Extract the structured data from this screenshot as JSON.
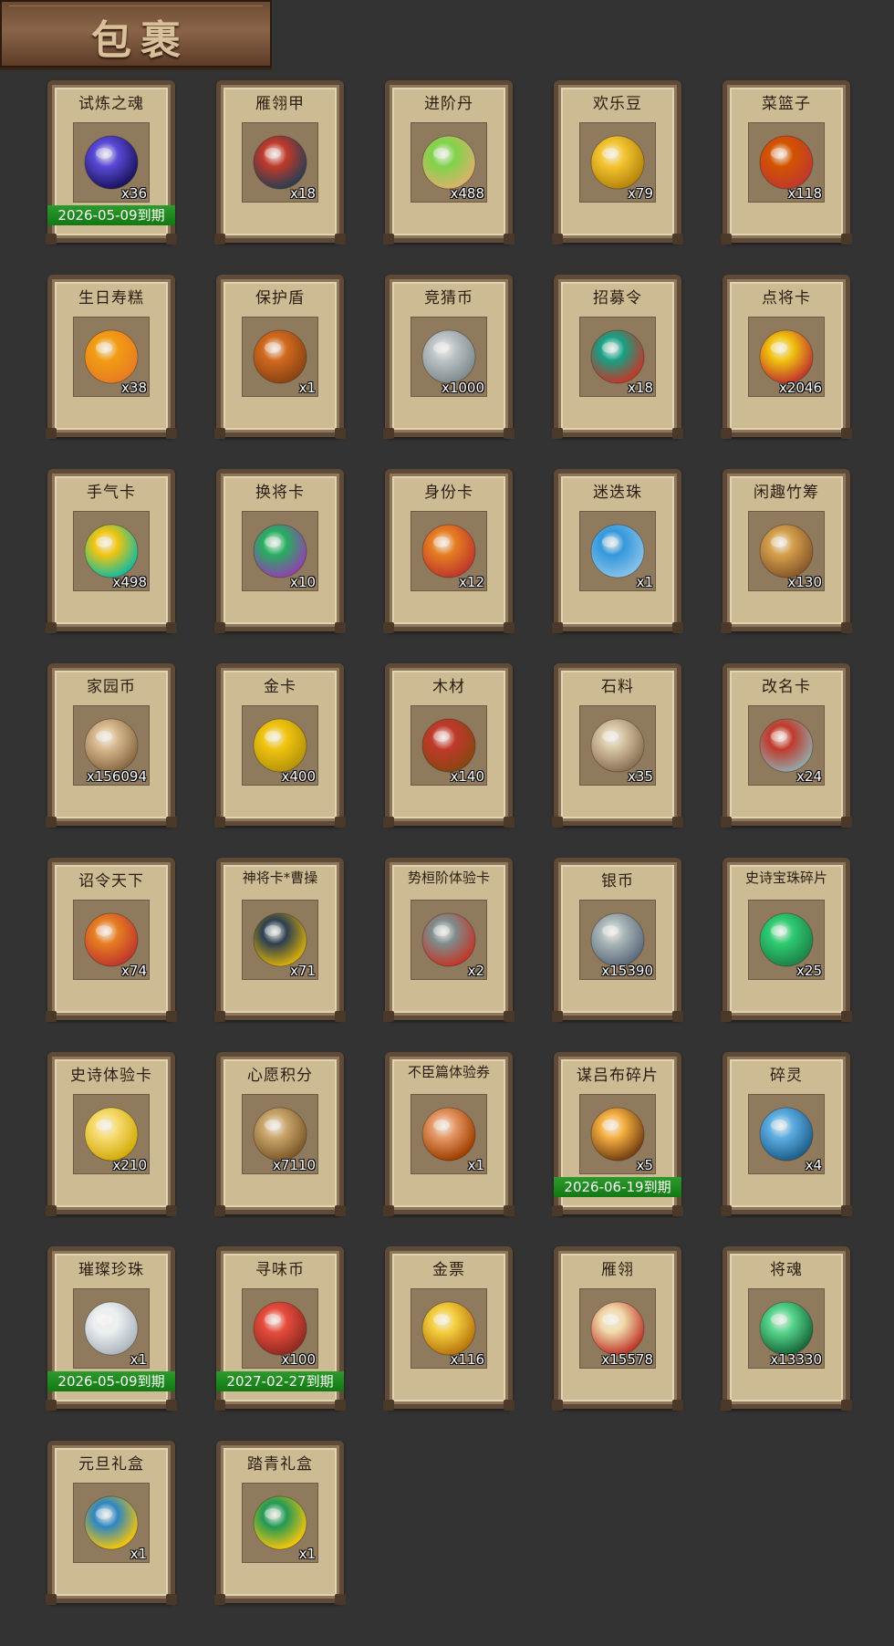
{
  "header": {
    "title": "包裹"
  },
  "items": [
    {
      "name": "试炼之魂",
      "count": "x36",
      "expiry": "2026-05-09到期",
      "icon": "soul-orb-icon",
      "colors": [
        "#5a4ad8",
        "#1b1560"
      ]
    },
    {
      "name": "雁翎甲",
      "count": "x18",
      "expiry": "",
      "icon": "armor-icon",
      "colors": [
        "#c0392b",
        "#2c3e50"
      ]
    },
    {
      "name": "进阶丹",
      "count": "x488",
      "expiry": "",
      "icon": "pill-icon",
      "colors": [
        "#7fd34a",
        "#d9b36b"
      ]
    },
    {
      "name": "欢乐豆",
      "count": "x79",
      "expiry": "",
      "icon": "beans-icon",
      "colors": [
        "#f4c531",
        "#b8860b"
      ]
    },
    {
      "name": "菜篮子",
      "count": "x118",
      "expiry": "",
      "icon": "basket-icon",
      "colors": [
        "#d35400",
        "#c0392b"
      ]
    },
    {
      "name": "生日寿糕",
      "count": "x38",
      "expiry": "",
      "icon": "cake-icon",
      "colors": [
        "#f39c12",
        "#e67e22"
      ]
    },
    {
      "name": "保护盾",
      "count": "x1",
      "expiry": "",
      "icon": "shield-icon",
      "colors": [
        "#d2691e",
        "#8b4513"
      ]
    },
    {
      "name": "竞猜币",
      "count": "x1000",
      "expiry": "",
      "icon": "silver-coin-icon",
      "colors": [
        "#bdc3c7",
        "#7f8c8d"
      ]
    },
    {
      "name": "招募令",
      "count": "x18",
      "expiry": "",
      "icon": "recruit-token-icon",
      "colors": [
        "#16a085",
        "#c0392b"
      ]
    },
    {
      "name": "点将卡",
      "count": "x2046",
      "expiry": "",
      "icon": "general-card-icon",
      "colors": [
        "#f1c40f",
        "#c0392b"
      ]
    },
    {
      "name": "手气卡",
      "count": "x498",
      "expiry": "",
      "icon": "luck-card-icon",
      "colors": [
        "#f1c40f",
        "#1abc9c"
      ]
    },
    {
      "name": "换将卡",
      "count": "x10",
      "expiry": "",
      "icon": "swap-card-icon",
      "colors": [
        "#27ae60",
        "#8e44ad"
      ]
    },
    {
      "name": "身份卡",
      "count": "x12",
      "expiry": "",
      "icon": "identity-card-icon",
      "colors": [
        "#e67e22",
        "#c0392b"
      ]
    },
    {
      "name": "迷迭珠",
      "count": "x1",
      "expiry": "",
      "icon": "blue-orb-icon",
      "colors": [
        "#3498db",
        "#85c1e9"
      ]
    },
    {
      "name": "闲趣竹筹",
      "count": "x130",
      "expiry": "",
      "icon": "bamboo-tally-icon",
      "colors": [
        "#d4a04c",
        "#8b5a2b"
      ]
    },
    {
      "name": "家园币",
      "count": "x156094",
      "expiry": "",
      "icon": "home-coin-icon",
      "colors": [
        "#d7b98e",
        "#8b6b45"
      ]
    },
    {
      "name": "金卡",
      "count": "x400",
      "expiry": "",
      "icon": "gold-card-icon",
      "colors": [
        "#f1c40f",
        "#b7950b"
      ]
    },
    {
      "name": "木材",
      "count": "x140",
      "expiry": "",
      "icon": "wood-icon",
      "colors": [
        "#c0392b",
        "#8b4513"
      ]
    },
    {
      "name": "石料",
      "count": "x35",
      "expiry": "",
      "icon": "stone-icon",
      "colors": [
        "#d7c4a3",
        "#8b7355"
      ]
    },
    {
      "name": "改名卡",
      "count": "x24",
      "expiry": "",
      "icon": "rename-card-icon",
      "colors": [
        "#c0392b",
        "#95a5a6"
      ]
    },
    {
      "name": "诏令天下",
      "count": "x74",
      "expiry": "",
      "icon": "scroll-icon",
      "colors": [
        "#e67e22",
        "#c0392b"
      ]
    },
    {
      "name": "神将卡*曹操",
      "count": "x71",
      "expiry": "",
      "icon": "hero-portrait-icon",
      "colors": [
        "#2c3e50",
        "#d4ac0d"
      ]
    },
    {
      "name": "势桓阶体验卡",
      "count": "x2",
      "expiry": "",
      "icon": "hero-trial-icon",
      "colors": [
        "#7f8c8d",
        "#c0392b"
      ]
    },
    {
      "name": "银币",
      "count": "x15390",
      "expiry": "",
      "icon": "silver-coins-icon",
      "colors": [
        "#aab7b8",
        "#5d6d7e"
      ]
    },
    {
      "name": "史诗宝珠碎片",
      "count": "x25",
      "expiry": "",
      "icon": "green-shard-icon",
      "colors": [
        "#2ecc71",
        "#1e8449"
      ]
    },
    {
      "name": "史诗体验卡",
      "count": "x210",
      "expiry": "",
      "icon": "epic-card-icon",
      "colors": [
        "#f7dc6f",
        "#d4ac0d"
      ]
    },
    {
      "name": "心愿积分",
      "count": "x7110",
      "expiry": "",
      "icon": "heart-coin-icon",
      "colors": [
        "#c9a66b",
        "#7e5a2a"
      ]
    },
    {
      "name": "不臣篇体验券",
      "count": "x1",
      "expiry": "",
      "icon": "ticket-icon",
      "colors": [
        "#e59866",
        "#a04000"
      ]
    },
    {
      "name": "谋吕布碎片",
      "count": "x5",
      "expiry": "2026-06-19到期",
      "icon": "puzzle-icon",
      "colors": [
        "#f5b041",
        "#784212"
      ]
    },
    {
      "name": "碎灵",
      "count": "x4",
      "expiry": "",
      "icon": "crystal-icon",
      "colors": [
        "#5dade2",
        "#1f618d"
      ]
    },
    {
      "name": "璀璨珍珠",
      "count": "x1",
      "expiry": "2026-05-09到期",
      "icon": "pearl-icon",
      "colors": [
        "#ecf0f1",
        "#aeb6bf"
      ]
    },
    {
      "name": "寻味币",
      "count": "x100",
      "expiry": "2027-02-27到期",
      "icon": "taste-coin-icon",
      "colors": [
        "#e74c3c",
        "#922b21"
      ]
    },
    {
      "name": "金票",
      "count": "x116",
      "expiry": "",
      "icon": "gold-ticket-icon",
      "colors": [
        "#f4d03f",
        "#b9770e"
      ]
    },
    {
      "name": "雁翎",
      "count": "x15578",
      "expiry": "",
      "icon": "feather-icon",
      "colors": [
        "#f0d9a8",
        "#c0392b"
      ]
    },
    {
      "name": "将魂",
      "count": "x13330",
      "expiry": "",
      "icon": "green-soul-icon",
      "colors": [
        "#58d68d",
        "#186a3b"
      ]
    },
    {
      "name": "元旦礼盒",
      "count": "x1",
      "expiry": "",
      "icon": "blue-gift-icon",
      "colors": [
        "#2e86c1",
        "#f1c40f"
      ]
    },
    {
      "name": "踏青礼盒",
      "count": "x1",
      "expiry": "",
      "icon": "green-gift-icon",
      "colors": [
        "#229954",
        "#f1c40f"
      ]
    }
  ]
}
